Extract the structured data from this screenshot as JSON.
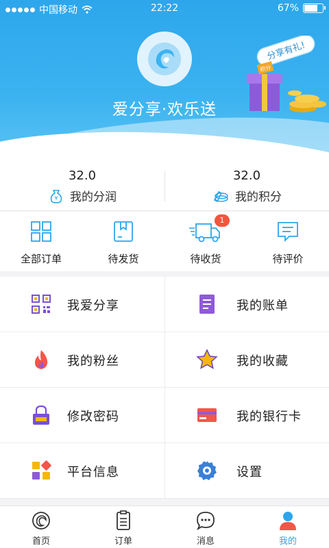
{
  "status_bar": {
    "carrier": "中国移动",
    "time": "22:22",
    "battery": "67%"
  },
  "header": {
    "slogan": "爱分享·欢乐送",
    "gift_tag": "分享有礼!",
    "gift_box_label": "积分"
  },
  "stats": [
    {
      "value": "32.0",
      "label": "我的分润",
      "icon": "money-bag-icon"
    },
    {
      "value": "32.0",
      "label": "我的积分",
      "icon": "coins-icon"
    }
  ],
  "orders": [
    {
      "label": "全部订单",
      "icon": "grid-icon"
    },
    {
      "label": "待发货",
      "icon": "package-icon"
    },
    {
      "label": "待收货",
      "icon": "truck-icon",
      "badge": "1"
    },
    {
      "label": "待评价",
      "icon": "comment-icon"
    }
  ],
  "menu": [
    {
      "label": "我爱分享",
      "icon": "qr-code-icon"
    },
    {
      "label": "我的账单",
      "icon": "bill-icon"
    },
    {
      "label": "我的粉丝",
      "icon": "flame-icon"
    },
    {
      "label": "我的收藏",
      "icon": "star-icon"
    },
    {
      "label": "修改密码",
      "icon": "lock-icon"
    },
    {
      "label": "我的银行卡",
      "icon": "bank-card-icon"
    },
    {
      "label": "平台信息",
      "icon": "apps-icon"
    },
    {
      "label": "设置",
      "icon": "settings-icon"
    }
  ],
  "tabs": [
    {
      "label": "首页",
      "icon": "home-icon"
    },
    {
      "label": "订单",
      "icon": "order-icon"
    },
    {
      "label": "消息",
      "icon": "message-icon"
    },
    {
      "label": "我的",
      "icon": "profile-icon",
      "active": true
    }
  ],
  "colors": {
    "primary": "#2da6ec",
    "badge": "#f4543e",
    "purple": "#7b4fd6",
    "gold": "#f5b70a"
  }
}
